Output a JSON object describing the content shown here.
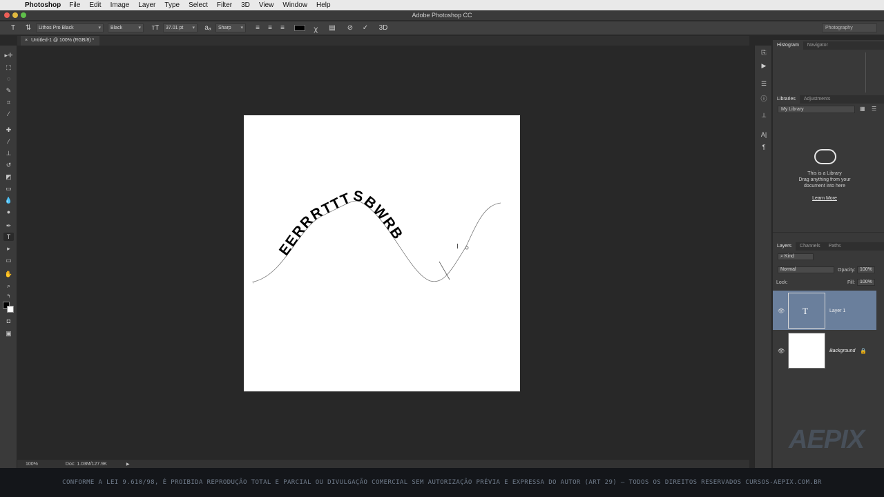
{
  "menubar": {
    "app_name": "Photoshop",
    "items": [
      "File",
      "Edit",
      "Image",
      "Layer",
      "Type",
      "Select",
      "Filter",
      "3D",
      "View",
      "Window",
      "Help"
    ]
  },
  "window": {
    "title": "Adobe Photoshop CC"
  },
  "options_bar": {
    "font_family": "Lithos Pro Black",
    "font_style": "Black",
    "font_size": "37.01 pt",
    "anti_alias": "Sharp",
    "text_color": "#000000",
    "workspace": "Photography"
  },
  "document": {
    "tab_label": "Untitled-1 @ 100% (RGB/8) *",
    "path_text": "EERRRTTTSBWRB"
  },
  "status": {
    "zoom": "100%",
    "doc_info": "Doc: 1.03M/127.9K"
  },
  "panels": {
    "top_tabs": [
      "Histogram",
      "Navigator"
    ],
    "library_tabs": [
      "Libraries",
      "Adjustments"
    ],
    "library_select": "My Library",
    "library_message": [
      "This is a Library",
      "Drag anything from your",
      "document into here"
    ],
    "learn_more": "Learn More",
    "layer_tabs": [
      "Layers",
      "Channels",
      "Paths"
    ],
    "filter_kind": "Kind",
    "blend_mode": "Normal",
    "opacity_label": "Opacity:",
    "opacity_value": "100%",
    "lock_label": "Lock:",
    "fill_label": "Fill:",
    "fill_value": "100%",
    "layers": [
      {
        "name": "Layer 1",
        "type": "text",
        "selected": true
      },
      {
        "name": "Background",
        "type": "background",
        "selected": false
      }
    ]
  },
  "footer": {
    "notice": "CONFORME A LEI 9.610/98, É PROIBIDA REPRODUÇÃO TOTAL E PARCIAL OU DIVULGAÇÃO COMERCIAL SEM AUTORIZAÇÃO PRÉVIA E EXPRESSA DO AUTOR (ART 29) — TODOS OS DIREITOS RESERVADOS CURSOS-AEPIX.COM.BR"
  },
  "watermark": {
    "brand": "AEPIX"
  },
  "colors": {
    "selected_layer": "#6a7f9c",
    "panel_bg": "#393939",
    "canvas_bg": "#282828"
  }
}
